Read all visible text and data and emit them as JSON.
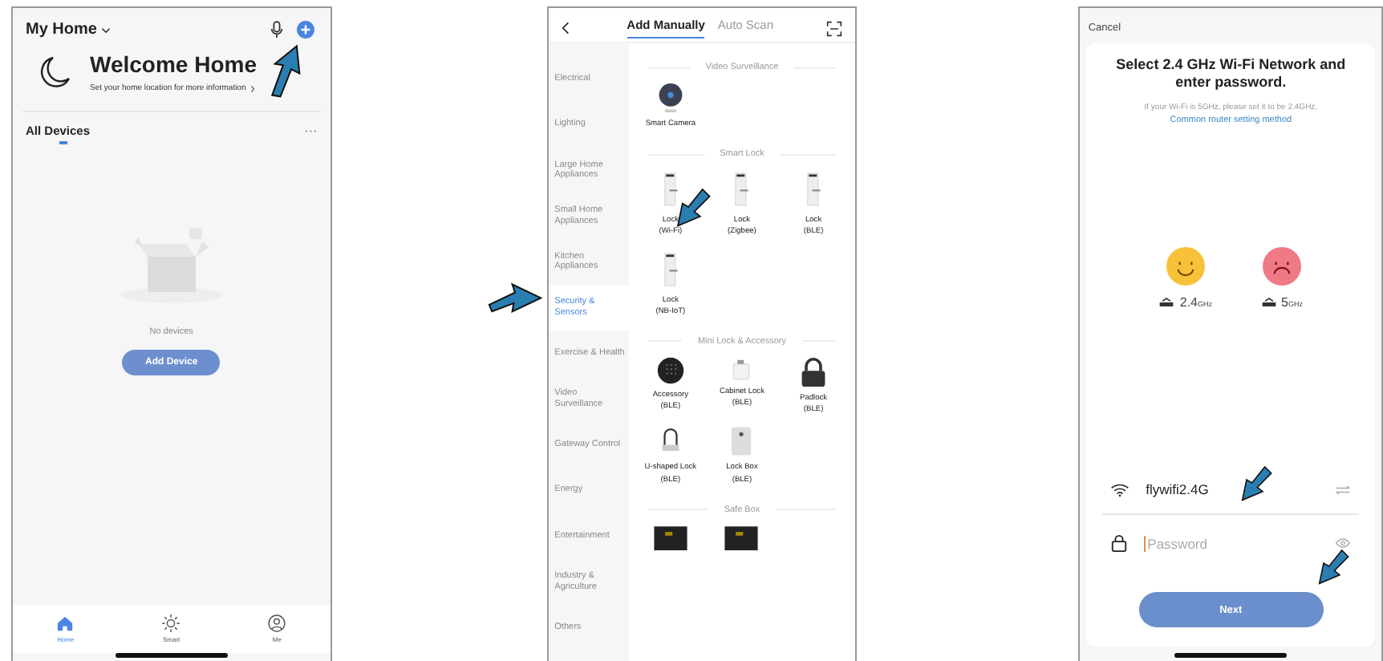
{
  "home_screen": {
    "home_name": "My Home",
    "welcome_title": "Welcome Home",
    "welcome_subtitle": "Set your home location for more information",
    "section_title": "All Devices",
    "more": "···",
    "empty_text": "No devices",
    "add_button": "Add Device",
    "nav": [
      {
        "label": "Home",
        "kind": "home",
        "selected": true
      },
      {
        "label": "Smart",
        "kind": "smart",
        "selected": false
      },
      {
        "label": "Me",
        "kind": "me",
        "selected": false
      }
    ]
  },
  "add_screen": {
    "tabs": [
      {
        "label": "Add Manually",
        "selected": true
      },
      {
        "label": "Auto Scan",
        "selected": false
      }
    ],
    "categories": [
      {
        "label": "Electrical",
        "selected": false
      },
      {
        "label": "Lighting",
        "selected": false
      },
      {
        "label": "Large Home Appliances",
        "selected": false
      },
      {
        "label": "Small Home Appliances",
        "selected": false
      },
      {
        "label": "Kitchen Appliances",
        "selected": false
      },
      {
        "label": "Security & Sensors",
        "selected": true
      },
      {
        "label": "Exercise & Health",
        "selected": false
      },
      {
        "label": "Video Surveillance",
        "selected": false
      },
      {
        "label": "Gateway Control",
        "selected": false
      },
      {
        "label": "Energy",
        "selected": false
      },
      {
        "label": "Entertainment",
        "selected": false
      },
      {
        "label": "Industry & Agriculture",
        "selected": false
      },
      {
        "label": "Others",
        "selected": false
      }
    ],
    "sections": [
      {
        "title": "Video Surveillance",
        "items": [
          {
            "kind": "camera",
            "name": "Smart Camera"
          }
        ]
      },
      {
        "title": "Smart Lock",
        "items": [
          {
            "kind": "lock",
            "name": "Lock",
            "sub": "(Wi-Fi)"
          },
          {
            "kind": "lock",
            "name": "Lock",
            "sub": "(Zigbee)"
          },
          {
            "kind": "lock",
            "name": "Lock",
            "sub": "(BLE)"
          },
          {
            "kind": "lock",
            "name": "Lock",
            "sub": "(NB-IoT)"
          }
        ]
      },
      {
        "title": "Mini Lock & Accessory",
        "items": [
          {
            "kind": "keypad",
            "name": "Accessory",
            "sub": "(BLE)"
          },
          {
            "kind": "cabinet",
            "name": "Cabinet Lock",
            "sub": "(BLE)"
          },
          {
            "kind": "padlock",
            "name": "Padlock",
            "sub": "(BLE)"
          },
          {
            "kind": "ulock",
            "name": "U-shaped Lock",
            "sub": "(BLE)"
          },
          {
            "kind": "lockbox",
            "name": "Lock Box",
            "sub": "(BLE)"
          }
        ]
      },
      {
        "title": "Safe Box",
        "items": [
          {
            "kind": "safe"
          },
          {
            "kind": "safe"
          }
        ]
      }
    ]
  },
  "wifi_screen": {
    "cancel": "Cancel",
    "title": "Select 2.4 GHz Wi-Fi Network and enter password.",
    "note": "If your Wi-Fi is 5GHz, please set it to be 2.4GHz.",
    "link": "Common router setting method",
    "bands": [
      {
        "kind": "good",
        "value": "2.4",
        "unit": "GHz"
      },
      {
        "kind": "bad",
        "value": "5",
        "unit": "GHz"
      }
    ],
    "ssid": "flywifi2.4G",
    "password_placeholder": "Password",
    "next_button": "Next"
  }
}
